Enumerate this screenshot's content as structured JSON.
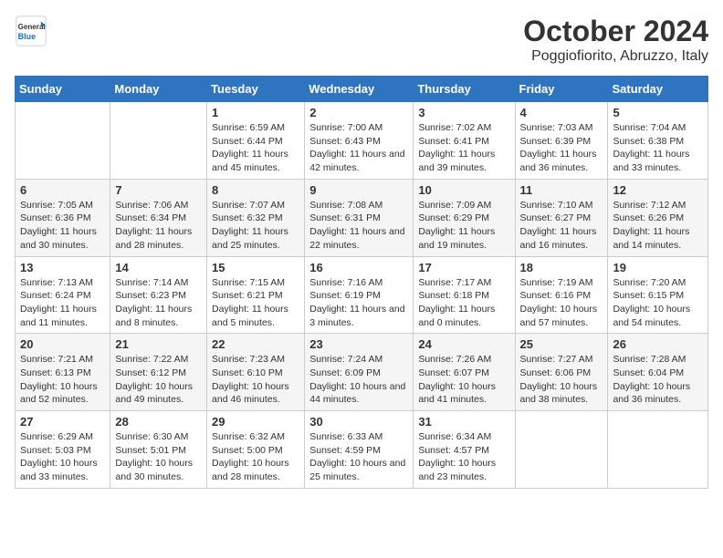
{
  "header": {
    "logo_general": "General",
    "logo_blue": "Blue",
    "month_title": "October 2024",
    "location": "Poggiofiorito, Abruzzo, Italy"
  },
  "days_of_week": [
    "Sunday",
    "Monday",
    "Tuesday",
    "Wednesday",
    "Thursday",
    "Friday",
    "Saturday"
  ],
  "weeks": [
    [
      {
        "day": "",
        "info": ""
      },
      {
        "day": "",
        "info": ""
      },
      {
        "day": "1",
        "info": "Sunrise: 6:59 AM\nSunset: 6:44 PM\nDaylight: 11 hours and 45 minutes."
      },
      {
        "day": "2",
        "info": "Sunrise: 7:00 AM\nSunset: 6:43 PM\nDaylight: 11 hours and 42 minutes."
      },
      {
        "day": "3",
        "info": "Sunrise: 7:02 AM\nSunset: 6:41 PM\nDaylight: 11 hours and 39 minutes."
      },
      {
        "day": "4",
        "info": "Sunrise: 7:03 AM\nSunset: 6:39 PM\nDaylight: 11 hours and 36 minutes."
      },
      {
        "day": "5",
        "info": "Sunrise: 7:04 AM\nSunset: 6:38 PM\nDaylight: 11 hours and 33 minutes."
      }
    ],
    [
      {
        "day": "6",
        "info": "Sunrise: 7:05 AM\nSunset: 6:36 PM\nDaylight: 11 hours and 30 minutes."
      },
      {
        "day": "7",
        "info": "Sunrise: 7:06 AM\nSunset: 6:34 PM\nDaylight: 11 hours and 28 minutes."
      },
      {
        "day": "8",
        "info": "Sunrise: 7:07 AM\nSunset: 6:32 PM\nDaylight: 11 hours and 25 minutes."
      },
      {
        "day": "9",
        "info": "Sunrise: 7:08 AM\nSunset: 6:31 PM\nDaylight: 11 hours and 22 minutes."
      },
      {
        "day": "10",
        "info": "Sunrise: 7:09 AM\nSunset: 6:29 PM\nDaylight: 11 hours and 19 minutes."
      },
      {
        "day": "11",
        "info": "Sunrise: 7:10 AM\nSunset: 6:27 PM\nDaylight: 11 hours and 16 minutes."
      },
      {
        "day": "12",
        "info": "Sunrise: 7:12 AM\nSunset: 6:26 PM\nDaylight: 11 hours and 14 minutes."
      }
    ],
    [
      {
        "day": "13",
        "info": "Sunrise: 7:13 AM\nSunset: 6:24 PM\nDaylight: 11 hours and 11 minutes."
      },
      {
        "day": "14",
        "info": "Sunrise: 7:14 AM\nSunset: 6:23 PM\nDaylight: 11 hours and 8 minutes."
      },
      {
        "day": "15",
        "info": "Sunrise: 7:15 AM\nSunset: 6:21 PM\nDaylight: 11 hours and 5 minutes."
      },
      {
        "day": "16",
        "info": "Sunrise: 7:16 AM\nSunset: 6:19 PM\nDaylight: 11 hours and 3 minutes."
      },
      {
        "day": "17",
        "info": "Sunrise: 7:17 AM\nSunset: 6:18 PM\nDaylight: 11 hours and 0 minutes."
      },
      {
        "day": "18",
        "info": "Sunrise: 7:19 AM\nSunset: 6:16 PM\nDaylight: 10 hours and 57 minutes."
      },
      {
        "day": "19",
        "info": "Sunrise: 7:20 AM\nSunset: 6:15 PM\nDaylight: 10 hours and 54 minutes."
      }
    ],
    [
      {
        "day": "20",
        "info": "Sunrise: 7:21 AM\nSunset: 6:13 PM\nDaylight: 10 hours and 52 minutes."
      },
      {
        "day": "21",
        "info": "Sunrise: 7:22 AM\nSunset: 6:12 PM\nDaylight: 10 hours and 49 minutes."
      },
      {
        "day": "22",
        "info": "Sunrise: 7:23 AM\nSunset: 6:10 PM\nDaylight: 10 hours and 46 minutes."
      },
      {
        "day": "23",
        "info": "Sunrise: 7:24 AM\nSunset: 6:09 PM\nDaylight: 10 hours and 44 minutes."
      },
      {
        "day": "24",
        "info": "Sunrise: 7:26 AM\nSunset: 6:07 PM\nDaylight: 10 hours and 41 minutes."
      },
      {
        "day": "25",
        "info": "Sunrise: 7:27 AM\nSunset: 6:06 PM\nDaylight: 10 hours and 38 minutes."
      },
      {
        "day": "26",
        "info": "Sunrise: 7:28 AM\nSunset: 6:04 PM\nDaylight: 10 hours and 36 minutes."
      }
    ],
    [
      {
        "day": "27",
        "info": "Sunrise: 6:29 AM\nSunset: 5:03 PM\nDaylight: 10 hours and 33 minutes."
      },
      {
        "day": "28",
        "info": "Sunrise: 6:30 AM\nSunset: 5:01 PM\nDaylight: 10 hours and 30 minutes."
      },
      {
        "day": "29",
        "info": "Sunrise: 6:32 AM\nSunset: 5:00 PM\nDaylight: 10 hours and 28 minutes."
      },
      {
        "day": "30",
        "info": "Sunrise: 6:33 AM\nSunset: 4:59 PM\nDaylight: 10 hours and 25 minutes."
      },
      {
        "day": "31",
        "info": "Sunrise: 6:34 AM\nSunset: 4:57 PM\nDaylight: 10 hours and 23 minutes."
      },
      {
        "day": "",
        "info": ""
      },
      {
        "day": "",
        "info": ""
      }
    ]
  ]
}
